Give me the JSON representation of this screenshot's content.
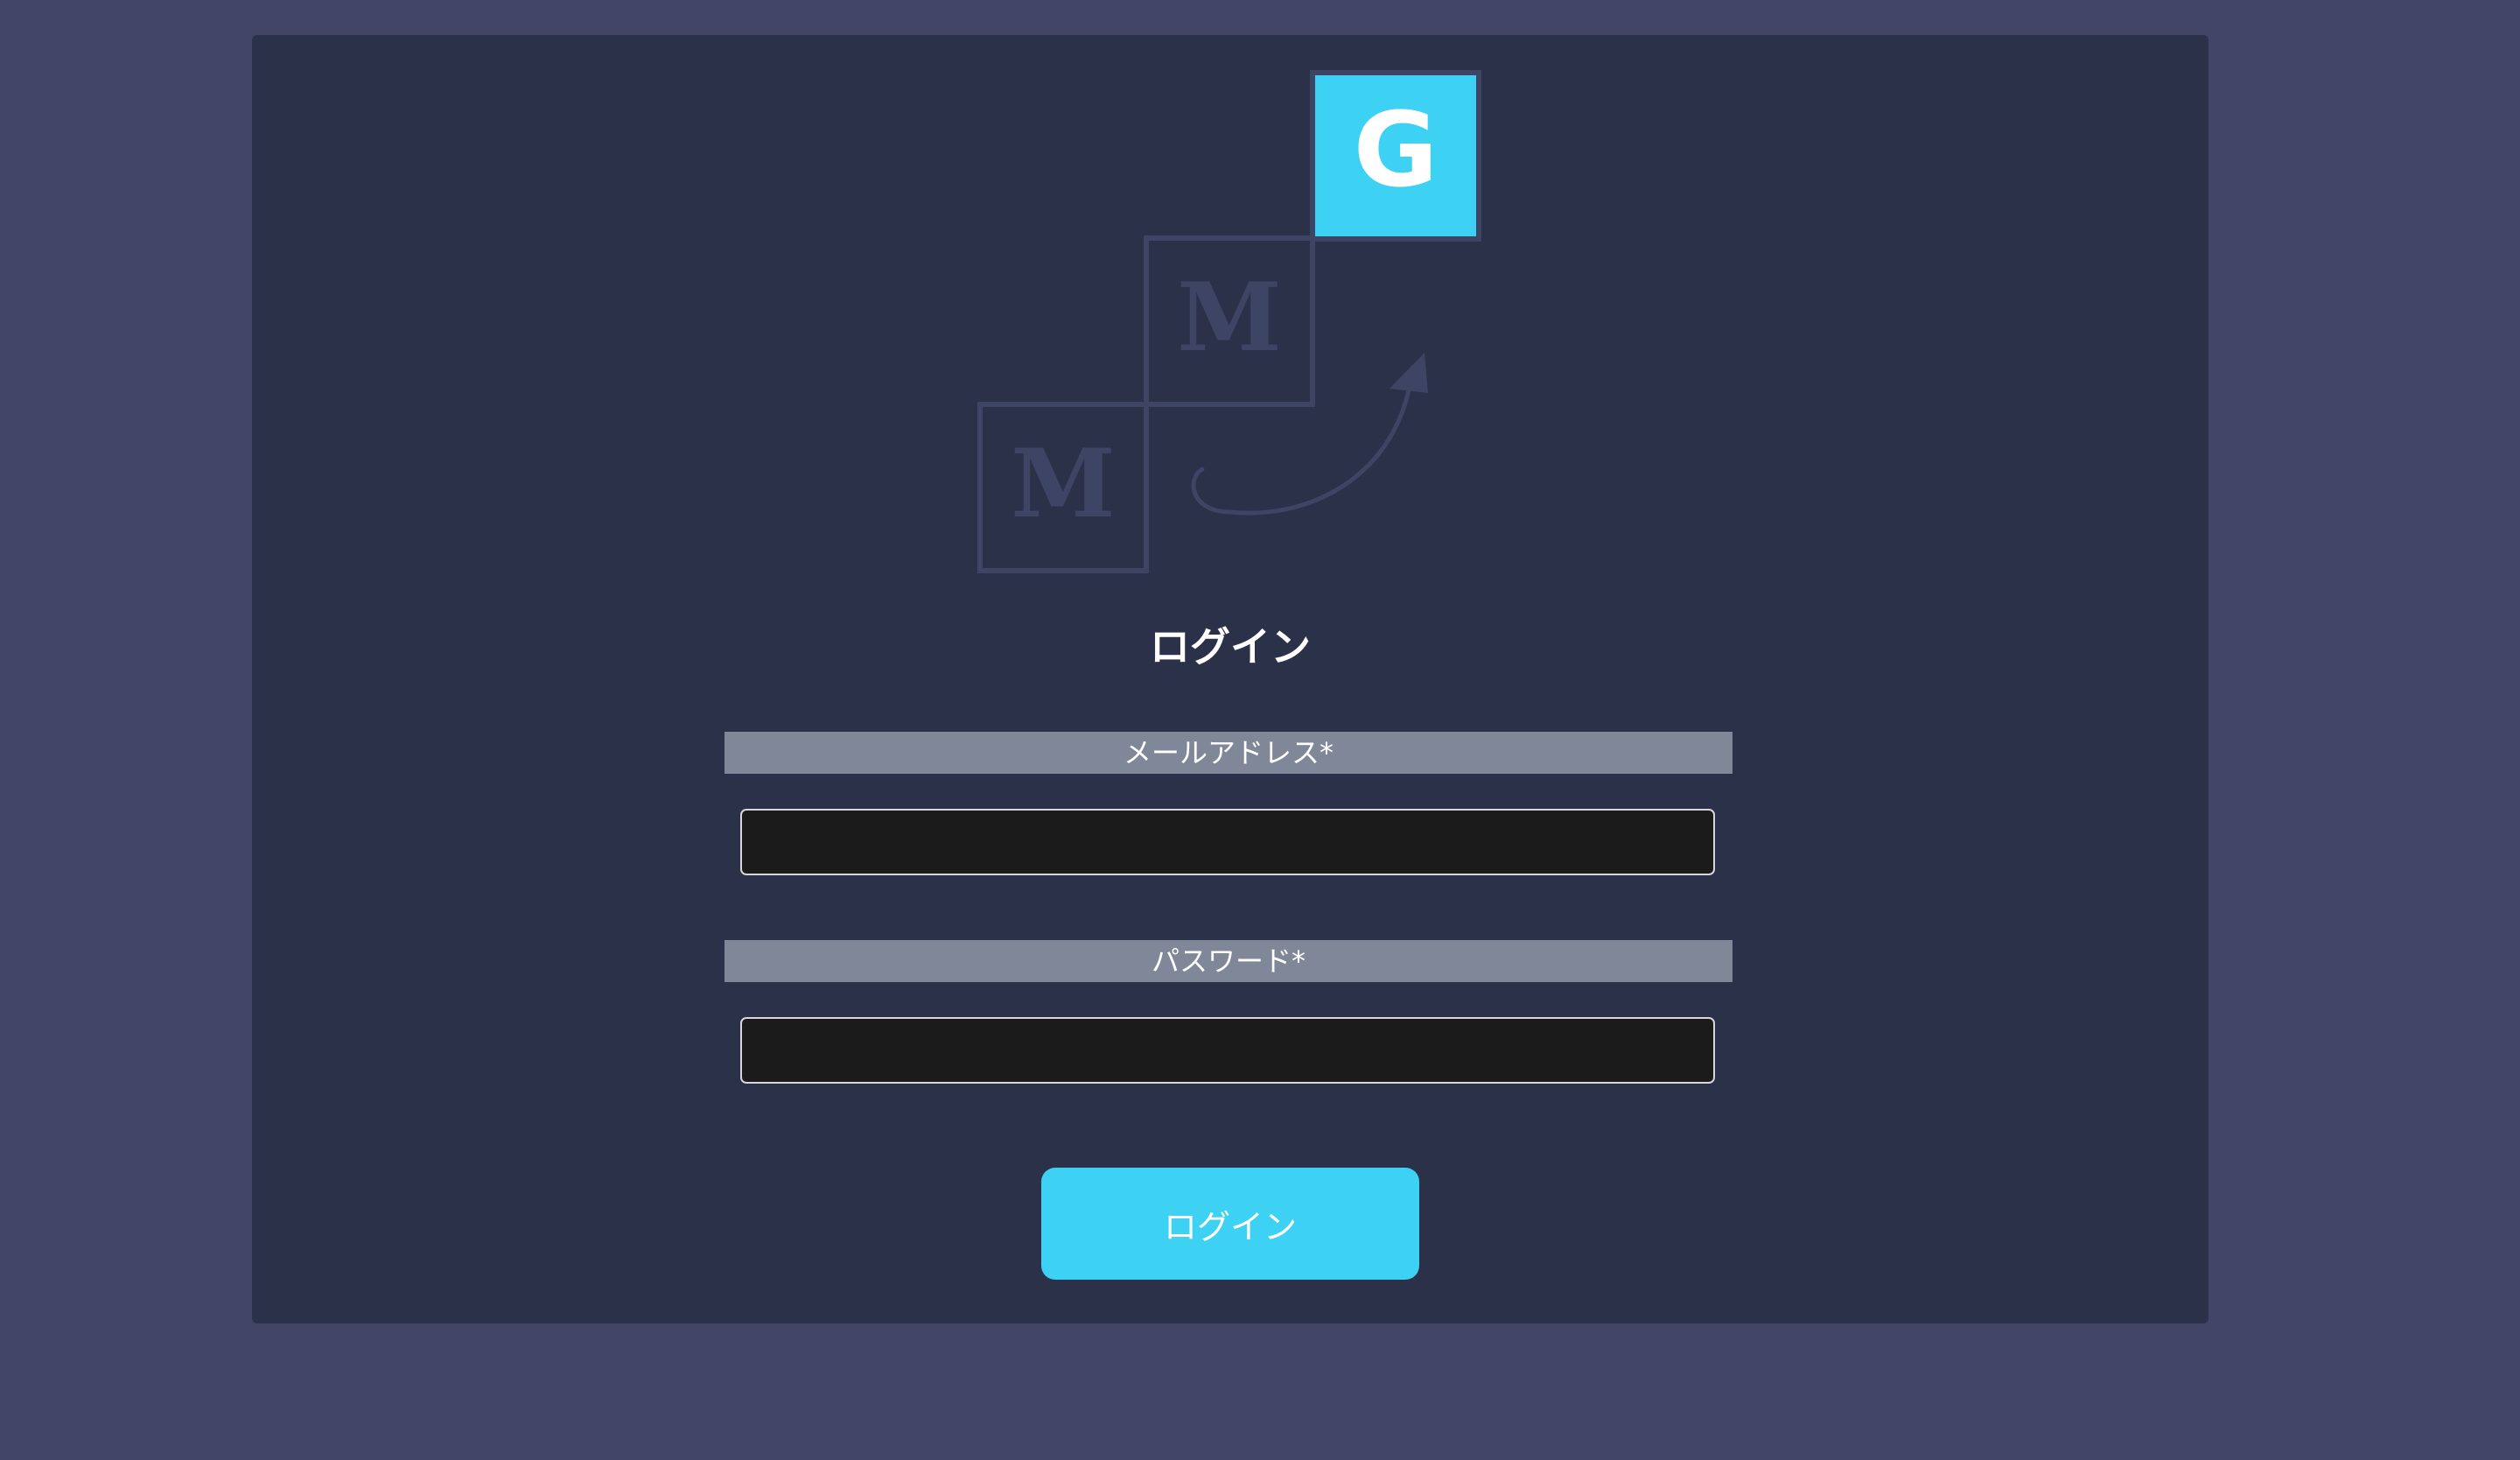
{
  "logo": {
    "letters": [
      "M",
      "M",
      "G"
    ],
    "accent_color": "#3dd1f3",
    "outline_color": "#3e4464",
    "icon": "arrow-up-right-icon"
  },
  "form": {
    "title": "ログイン",
    "email_label": "メールアドレス*",
    "email_value": "",
    "password_label": "パスワード*",
    "password_value": "",
    "submit_label": "ログイン"
  },
  "colors": {
    "page_bg": "#424566",
    "card_bg": "#2c314a",
    "label_bg": "#7f8799",
    "input_bg": "#1b1b1b",
    "button_bg": "#3dd1f3"
  }
}
